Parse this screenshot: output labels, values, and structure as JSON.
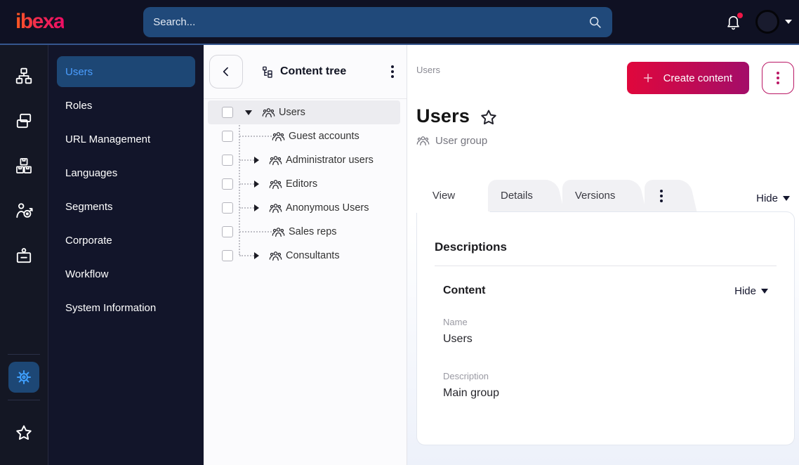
{
  "topbar": {
    "logo": "ibexa",
    "search": {
      "placeholder": "Search..."
    },
    "icons": {
      "bell": "bell-icon",
      "avatar": "user-avatar",
      "caret": "chevron-down-icon"
    },
    "notification_dot_color": "#ef1646"
  },
  "iconbar": {
    "items": [
      {
        "name": "content-structure-icon"
      },
      {
        "name": "pages-icon"
      },
      {
        "name": "products-icon"
      },
      {
        "name": "personalization-icon"
      },
      {
        "name": "admin-badge-icon"
      }
    ],
    "bottom": [
      {
        "name": "settings-gear-icon",
        "active": true
      },
      {
        "name": "bookmarks-star-icon"
      }
    ]
  },
  "sidebar": {
    "items": [
      {
        "label": "Users",
        "active": true
      },
      {
        "label": "Roles"
      },
      {
        "label": "URL Management"
      },
      {
        "label": "Languages"
      },
      {
        "label": "Segments"
      },
      {
        "label": "Corporate"
      },
      {
        "label": "Workflow"
      },
      {
        "label": "System Information"
      }
    ]
  },
  "content_tree": {
    "title": "Content tree",
    "items": [
      {
        "label": "Users",
        "level": 0,
        "expanded": true,
        "selected": true,
        "icon": "user-group-icon"
      },
      {
        "label": "Guest accounts",
        "level": 1,
        "leaf": true,
        "icon": "user-group-icon"
      },
      {
        "label": "Administrator users",
        "level": 1,
        "collapsed": true,
        "icon": "user-group-icon"
      },
      {
        "label": "Editors",
        "level": 1,
        "collapsed": true,
        "icon": "user-group-icon"
      },
      {
        "label": "Anonymous Users",
        "level": 1,
        "collapsed": true,
        "icon": "user-group-icon"
      },
      {
        "label": "Sales reps",
        "level": 1,
        "leaf": true,
        "icon": "user-group-icon"
      },
      {
        "label": "Consultants",
        "level": 1,
        "collapsed": true,
        "icon": "user-group-icon"
      }
    ]
  },
  "main": {
    "breadcrumb": "Users",
    "actions": {
      "create_label": "Create content"
    },
    "title": "Users",
    "content_type": "User group",
    "tabs": [
      {
        "label": "View",
        "active": true
      },
      {
        "label": "Details"
      },
      {
        "label": "Versions"
      }
    ],
    "hide_toggle": "Hide",
    "card": {
      "section_title": "Descriptions",
      "group": {
        "title": "Content",
        "hide_toggle": "Hide",
        "fields": [
          {
            "label": "Name",
            "value": "Users"
          },
          {
            "label": "Description",
            "value": "Main group"
          }
        ]
      }
    }
  },
  "colors": {
    "topbar_bg": "#0f1123",
    "sidebar_bg": "#12152a",
    "selected_item_bg": "#1d4775",
    "accent_blue": "#4b9eff",
    "search_bg": "#20497a",
    "brand_gradient_start": "#e0073c",
    "brand_gradient_end": "#a30d69",
    "magenta": "#ba1765",
    "notification_dot": "#ef1646"
  }
}
